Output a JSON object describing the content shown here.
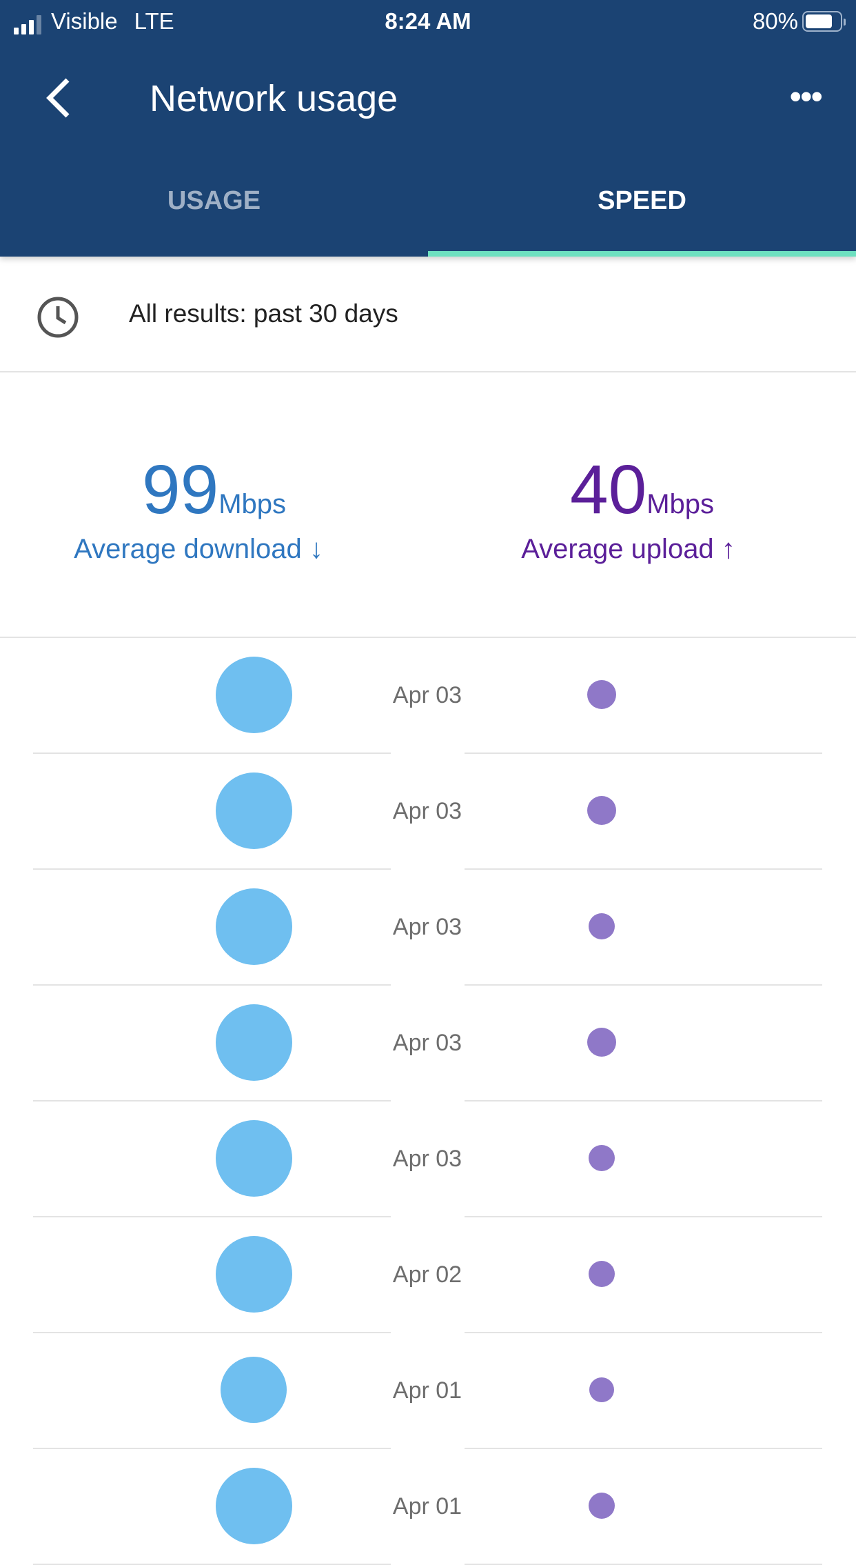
{
  "status_bar": {
    "carrier": "Visible",
    "network": "LTE",
    "time": "8:24 AM",
    "battery": "80%",
    "battery_level": 0.8
  },
  "header": {
    "title": "Network usage",
    "back_icon": "chevron-left-icon",
    "more_icon": "more-horizontal-icon"
  },
  "tabs": [
    {
      "label": "USAGE",
      "active": false
    },
    {
      "label": "SPEED",
      "active": true
    }
  ],
  "filter": {
    "icon": "clock-icon",
    "label": "All results: past 30 days"
  },
  "averages": {
    "download": {
      "value": "99",
      "unit": "Mbps",
      "label": "Average download ↓",
      "color": "#2f77c0"
    },
    "upload": {
      "value": "40",
      "unit": "Mbps",
      "label": "Average upload ↑",
      "color": "#5b1f99"
    }
  },
  "results": [
    {
      "date": "Apr 03"
    },
    {
      "date": "Apr 03"
    },
    {
      "date": "Apr 03"
    },
    {
      "date": "Apr 03"
    },
    {
      "date": "Apr 03"
    },
    {
      "date": "Apr 02"
    },
    {
      "date": "Apr 01"
    },
    {
      "date": "Apr 01"
    }
  ],
  "colors": {
    "header": "#1b4373",
    "tab_indicator": "#6ee0c0",
    "download_dot": "#6fbff0",
    "upload_dot": "#8f78c8"
  }
}
